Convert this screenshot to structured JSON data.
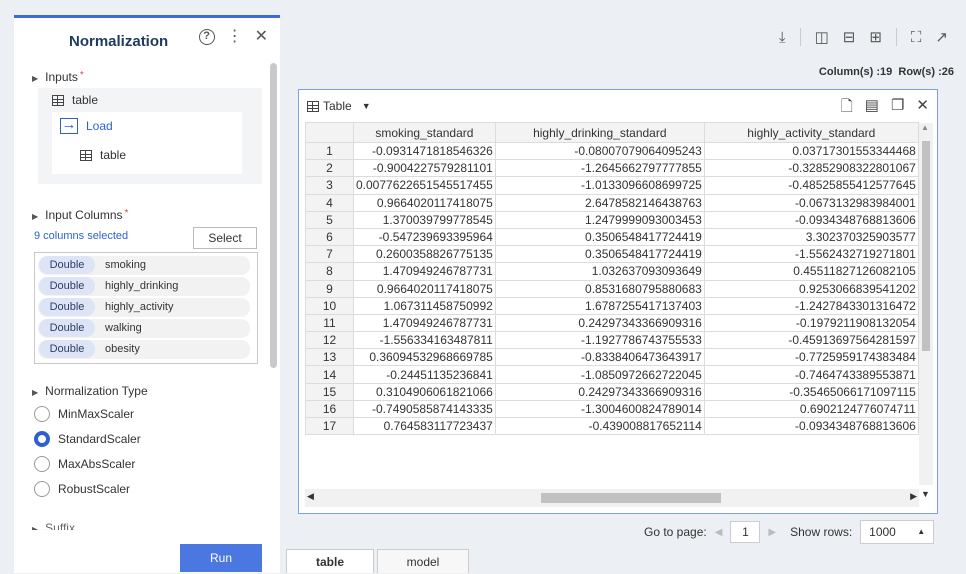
{
  "panel": {
    "title": "Normalization",
    "help_icon": "?",
    "inputs_label": "Inputs",
    "required_mark": "*",
    "input_table": "table",
    "load_label": "Load",
    "load_table": "table",
    "input_columns_label": "Input Columns",
    "columns_selected": "9 columns selected",
    "select_button": "Select",
    "columns": [
      {
        "type": "Double",
        "name": "smoking"
      },
      {
        "type": "Double",
        "name": "highly_drinking"
      },
      {
        "type": "Double",
        "name": "highly_activity"
      },
      {
        "type": "Double",
        "name": "walking"
      },
      {
        "type": "Double",
        "name": "obesity"
      }
    ],
    "normalization_type_label": "Normalization Type",
    "scalers": [
      "MinMaxScaler",
      "StandardScaler",
      "MaxAbsScaler",
      "RobustScaler"
    ],
    "selected_scaler": "StandardScaler",
    "suffix_label": "Suffix",
    "run_button": "Run"
  },
  "info": {
    "columns_count": "Column(s) :19",
    "rows_count": "Row(s) :26"
  },
  "table_panel": {
    "title": "Table",
    "headers": [
      "",
      "smoking_standard",
      "highly_drinking_standard",
      "highly_activity_standard"
    ],
    "rows": [
      [
        "1",
        "-0.0931471818546326",
        "-0.08007079064095243",
        "0.03717301553344468"
      ],
      [
        "2",
        "-0.9004227579281101",
        "-1.2645662797777855",
        "-0.32852908322801067"
      ],
      [
        "3",
        "0.0077622651545517455",
        "-1.0133096608699725",
        "-0.48525855412577645"
      ],
      [
        "4",
        "0.9664020117418075",
        "2.6478582146438763",
        "-0.0673132983984001"
      ],
      [
        "5",
        "1.370039799778545",
        "1.2479999093003453",
        "-0.0934348768813606"
      ],
      [
        "6",
        "-0.547239693395964",
        "0.3506548417724419",
        "3.302370325903577"
      ],
      [
        "7",
        "0.2600358826775135",
        "0.3506548417724419",
        "-1.5562432719271801"
      ],
      [
        "8",
        "1.470949246787731",
        "1.032637093093649",
        "0.45511827126082105"
      ],
      [
        "9",
        "0.9664020117418075",
        "0.8531680795880683",
        "0.9253066839541202"
      ],
      [
        "10",
        "1.067311458750992",
        "1.6787255417137403",
        "-1.2427843301316472"
      ],
      [
        "11",
        "1.470949246787731",
        "0.24297343366909316",
        "-0.1979211908132054"
      ],
      [
        "12",
        "-1.556334163487811",
        "-1.1927786743755533",
        "-0.45913697564281597"
      ],
      [
        "13",
        "0.36094532968669785",
        "-0.8338406473643917",
        "-0.7725959174383484"
      ],
      [
        "14",
        "-0.24451135236841",
        "-1.0850972662722045",
        "-0.7464743389553871"
      ],
      [
        "15",
        "0.3104906061821066",
        "0.24297343366909316",
        "-0.35465066171097115"
      ],
      [
        "16",
        "-0.7490585874143335",
        "-1.3004600824789014",
        "0.6902124776074711"
      ],
      [
        "17",
        "0.764583117723437",
        "-0.439008817652114",
        "-0.0934348768813606"
      ]
    ]
  },
  "pager": {
    "goto_label": "Go to page:",
    "page": "1",
    "show_rows_label": "Show rows:",
    "rows_value": "1000"
  },
  "tabs": [
    "table",
    "model"
  ]
}
